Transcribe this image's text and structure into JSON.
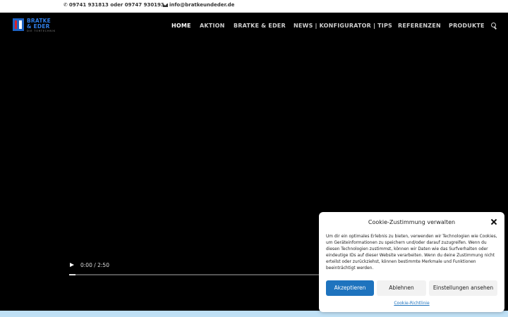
{
  "topbar": {
    "phone": "09741 931813 oder 09747 930193",
    "email": "info@bratkeundeder.de",
    "phone_icon": "phone-icon",
    "email_icon": "envelope-icon"
  },
  "logo": {
    "line1": "BRATKE",
    "line2": "& EDER",
    "tagline": "DIE TORTECHNIK"
  },
  "nav": {
    "items": [
      {
        "label": "HOME"
      },
      {
        "label": "AKTION"
      },
      {
        "label": "BRATKE & EDER"
      },
      {
        "label": "NEWS | KONFIGURATOR | TIPS"
      },
      {
        "label": "REFERENZEN"
      },
      {
        "label": "PRODUKTE"
      }
    ],
    "search_icon": "search-icon"
  },
  "video": {
    "time": "0:00 / 2:50",
    "progress": 0.0
  },
  "cookie": {
    "title": "Cookie-Zustimmung verwalten",
    "description": "Um dir ein optimales Erlebnis zu bieten, verwenden wir Technologien wie Cookies, um Geräteinformationen zu speichern und/oder darauf zuzugreifen. Wenn du diesen Technologien zustimmst, können wir Daten wie das Surfverhalten oder eindeutige IDs auf dieser Website verarbeiten. Wenn du deine Zustimmung nicht erteilst oder zurückziehst, können bestimmte Merkmale und Funktionen beeinträchtigt werden.",
    "accept_label": "Akzeptieren",
    "deny_label": "Ablehnen",
    "prefs_label": "Einstellungen ansehen",
    "policy_label": "Cookie-Richtlinie"
  },
  "colors": {
    "accent": "#1e73be",
    "logo_blue": "#2f7de6",
    "background": "#000000"
  }
}
